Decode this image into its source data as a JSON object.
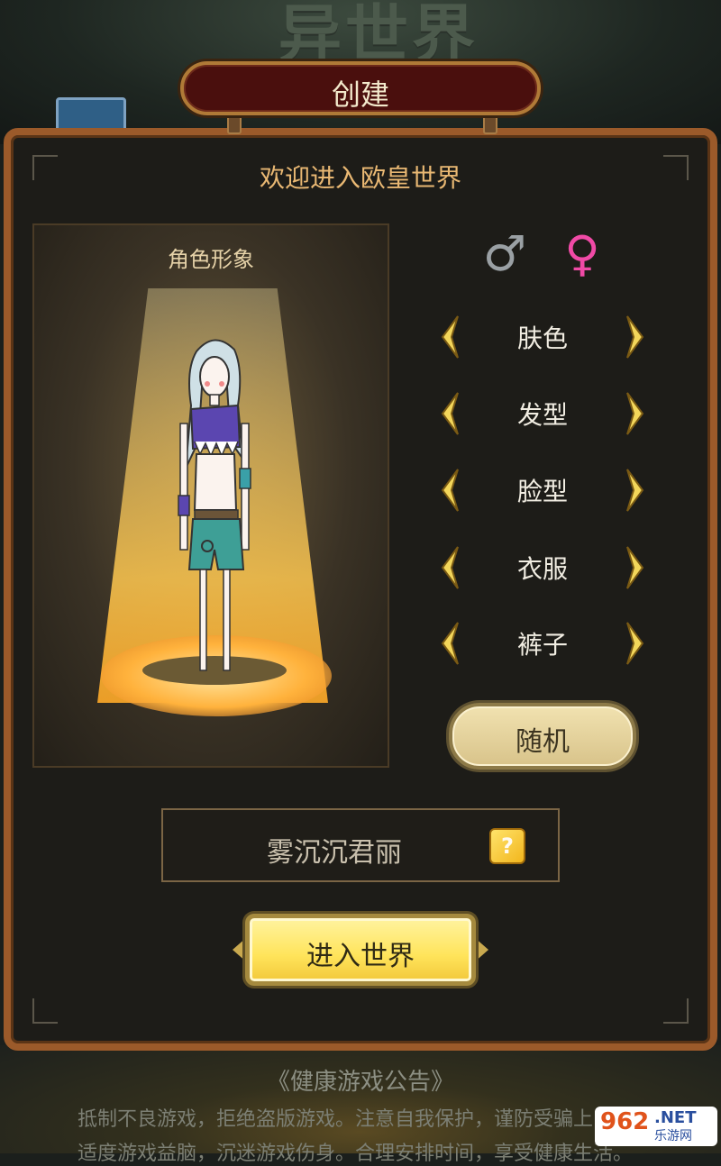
{
  "header": {
    "title": "创建"
  },
  "background": {
    "logo_text": "异世界",
    "notice": {
      "title": "《健康游戏公告》",
      "line1": "抵制不良游戏，拒绝盗版游戏。注意自我保护，谨防受骗上当。",
      "line2": "适度游戏益脑，沉迷游戏伤身。合理安排时间，享受健康生活。"
    }
  },
  "panel": {
    "welcome": "欢迎进入欧皇世界",
    "portrait_label": "角色形象",
    "gender": {
      "male": "♂",
      "female": "♀",
      "selected": "female"
    },
    "options": [
      "肤色",
      "发型",
      "脸型",
      "衣服",
      "裤子"
    ],
    "random_label": "随机",
    "name_value": "雾沉沉君丽",
    "dice_symbol": "?",
    "enter_label": "进入世界"
  },
  "watermark": {
    "num": "962",
    "net": ".NET",
    "cn": "乐游网"
  },
  "colors": {
    "accent": "#e9b873",
    "frame": "#9b5a2a",
    "female": "#f04aa6",
    "male": "#9aa0a4",
    "button": "#ffe45a"
  }
}
